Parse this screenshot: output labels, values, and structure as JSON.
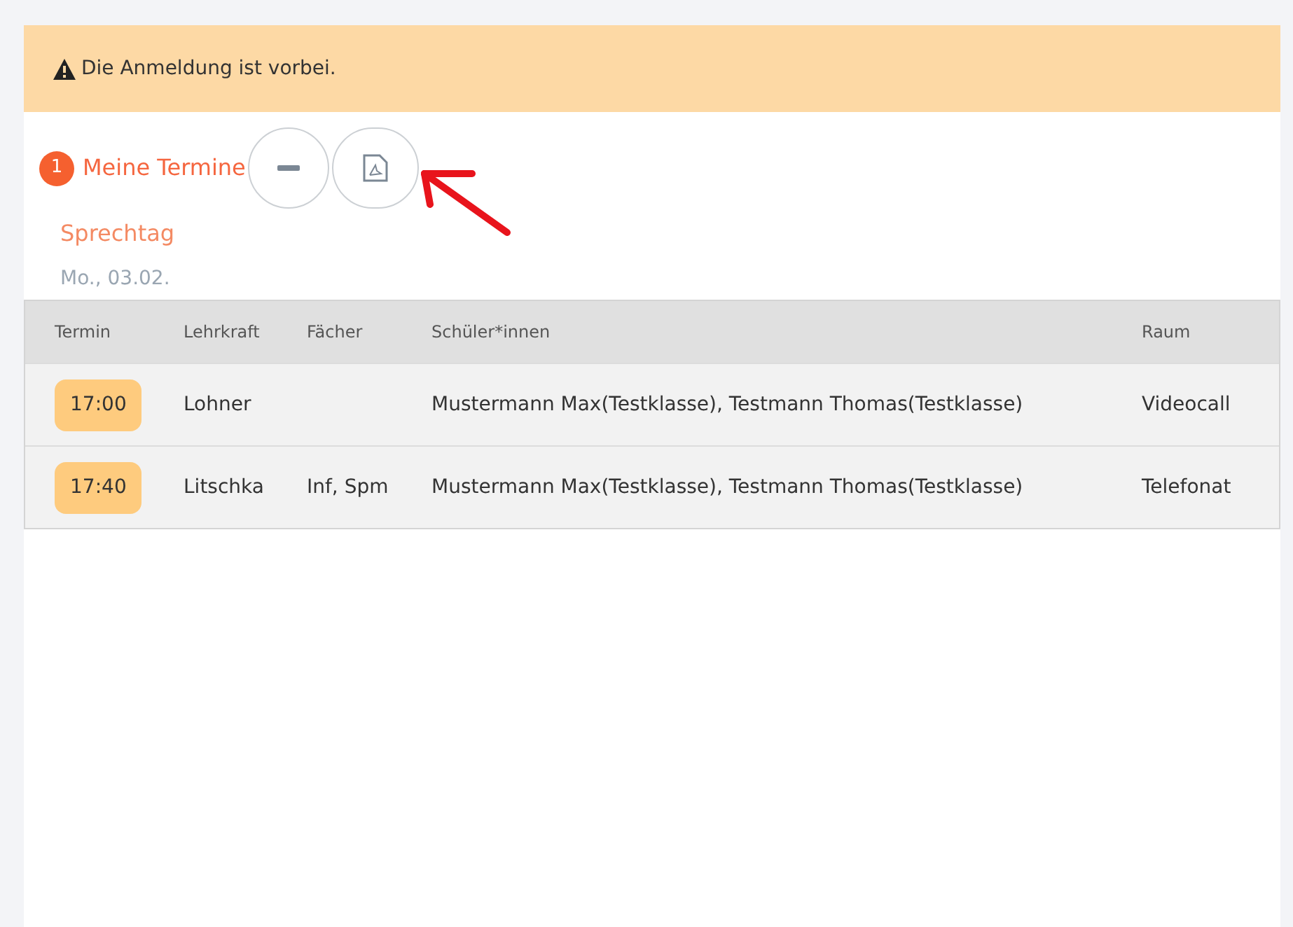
{
  "alert": {
    "text": "Die Anmeldung ist vorbei."
  },
  "section": {
    "badge": "1",
    "title": "Meine Termine"
  },
  "event": {
    "title": "Sprechtag",
    "date": "Mo., 03.02."
  },
  "table": {
    "columns": [
      "Termin",
      "Lehrkraft",
      "Fächer",
      "Schüler*innen",
      "Raum"
    ],
    "rows": [
      [
        "17:00",
        "Lohner",
        "",
        "Mustermann Max(Testklasse), Testmann Thomas(Testklasse)",
        "Videocall"
      ],
      [
        "17:40",
        "Litschka",
        "Inf, Spm",
        "Mustermann Max(Testklasse), Testmann Thomas(Testklasse)",
        "Telefonat"
      ]
    ]
  }
}
